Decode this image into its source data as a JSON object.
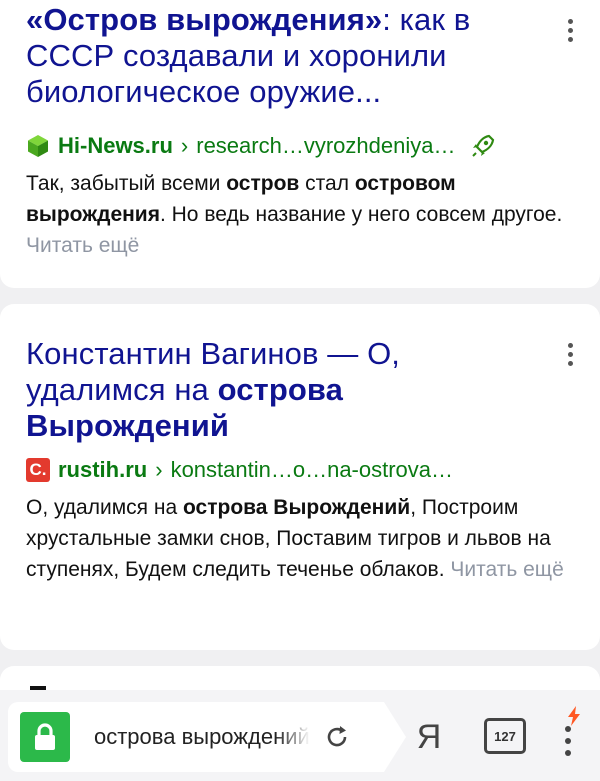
{
  "results": [
    {
      "title_parts": [
        "«Остров вырождения»",
        ": как в СССР создавали и хоронили биологическое оружие..."
      ],
      "site": "Hi-News.ru",
      "path_sep": "›",
      "path": "research…vyrozhdeniya…",
      "snippet": {
        "p1": "Так, забытый всеми ",
        "b1": "остров",
        "p2": " стал ",
        "b2": "островом вырождения",
        "p3": ". Но ведь название у него совсем другое. ",
        "read_more": "Читать ещё"
      }
    },
    {
      "title_parts": [
        "Константин Вагинов — О, удалимся на ",
        "острова Вырождений"
      ],
      "site": "rustih.ru",
      "path_sep": "›",
      "path": "konstantin…o…na-ostrova…",
      "favicon_letter": "C.",
      "snippet": {
        "p1": "О, удалимся на ",
        "b1": "острова Вырождений",
        "p2": ", Построим хрустальные замки снов, Поставим тигров и львов на ступенях, Будем следить теченье облаков. ",
        "read_more": "Читать ещё"
      }
    }
  ],
  "bottom_bar": {
    "query": "острова вырождений",
    "ya_label": "Я",
    "tabs_count": "127"
  },
  "colors": {
    "title": "#101491",
    "url_green": "#0a7a12",
    "lock_green": "#2cb94a",
    "bolt": "#ff5722"
  }
}
